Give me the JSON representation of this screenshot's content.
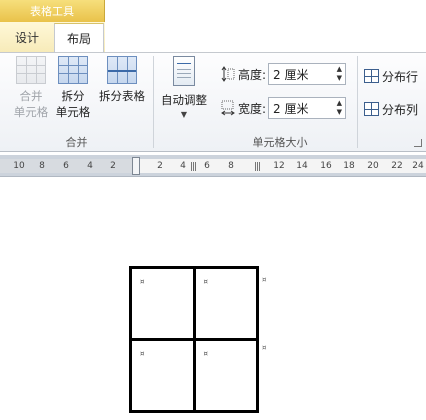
{
  "contextual_tab": "表格工具",
  "tabs": [
    {
      "label": "设计",
      "active": false
    },
    {
      "label": "布局",
      "active": true
    }
  ],
  "merge_group": {
    "label": "合并",
    "buttons": [
      {
        "label": "合并\n单元格",
        "line1": "合并",
        "line2": "单元格",
        "enabled": false
      },
      {
        "label": "拆分\n单元格",
        "line1": "拆分",
        "line2": "单元格",
        "enabled": true
      },
      {
        "label": "拆分表格",
        "line1": "拆分表格",
        "line2": "",
        "enabled": true
      }
    ]
  },
  "cell_size_group": {
    "label": "单元格大小",
    "autofit_label": "自动调整",
    "height_label": "高度:",
    "height_value": "2 厘米",
    "width_label": "宽度:",
    "width_value": "2 厘米",
    "distribute_rows": "分布行",
    "distribute_columns": "分布列"
  },
  "ruler": {
    "left_numbers": [
      "10",
      "8",
      "6",
      "4",
      "2",
      "2"
    ],
    "right_numbers": [
      "2",
      "4",
      "6",
      "8",
      "12",
      "14",
      "16",
      "18",
      "20",
      "22",
      "24"
    ]
  },
  "table": {
    "rows": 2,
    "cols": 2
  },
  "colors": {
    "contextual_header": "#e9c24a",
    "ribbon_background": "#eef1f5",
    "table_border": "#000000"
  }
}
